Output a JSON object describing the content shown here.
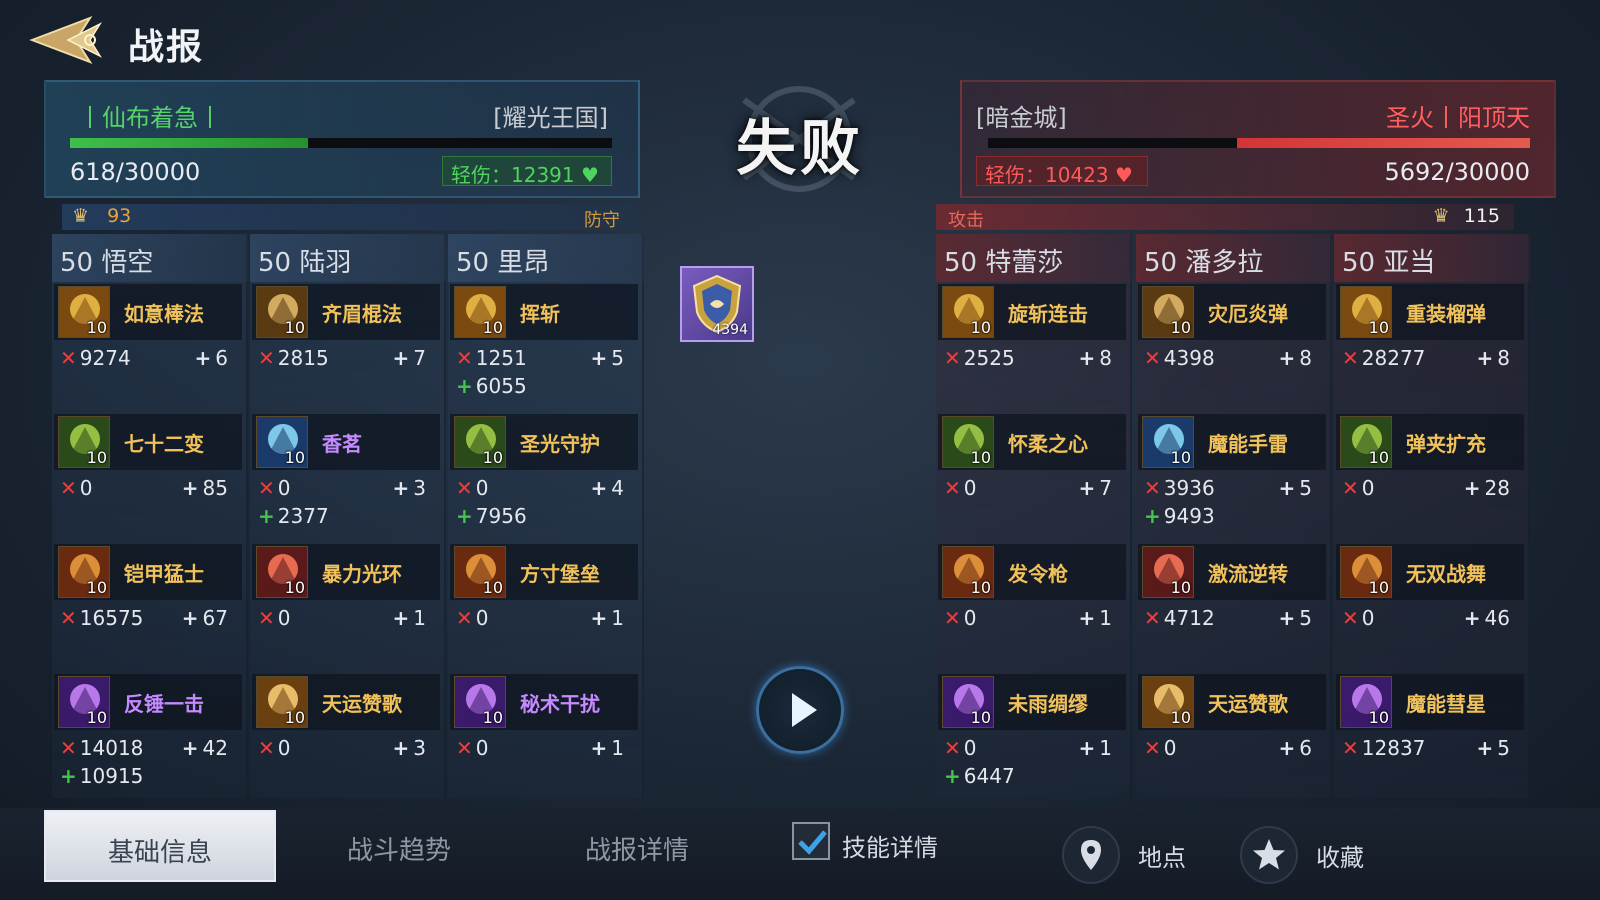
{
  "header": {
    "title": "战报"
  },
  "result": "失败",
  "left_player": {
    "name": "丨仙布着急丨",
    "kingdom": "[耀光王国]",
    "hp_text": "618/30000",
    "hp_fraction": 0.44,
    "injury": "轻伤：12391",
    "count": "93",
    "role": "防守"
  },
  "right_player": {
    "kingdom": "[暗金城]",
    "name": "圣火丨阳顶天",
    "hp_text": "5692/30000",
    "hp_fraction": 0.54,
    "injury": "轻伤：10423",
    "count": "115",
    "role": "攻击"
  },
  "center_item": {
    "count": "4394"
  },
  "left_heroes": [
    {
      "name": "50 悟空",
      "skills": [
        {
          "name": "如意棒法",
          "level": "10",
          "damage": "9274",
          "count": "6",
          "heal": ""
        },
        {
          "name": "七十二变",
          "level": "10",
          "damage": "0",
          "count": "85",
          "heal": ""
        },
        {
          "name": "铠甲猛士",
          "level": "10",
          "damage": "16575",
          "count": "67",
          "heal": ""
        },
        {
          "name": "反锤一击",
          "level": "10",
          "damage": "14018",
          "count": "42",
          "heal": "10915"
        }
      ]
    },
    {
      "name": "50 陆羽",
      "skills": [
        {
          "name": "齐眉棍法",
          "level": "10",
          "damage": "2815",
          "count": "7",
          "heal": ""
        },
        {
          "name": "香茗",
          "level": "10",
          "damage": "0",
          "count": "3",
          "heal": "2377"
        },
        {
          "name": "暴力光环",
          "level": "10",
          "damage": "0",
          "count": "1",
          "heal": ""
        },
        {
          "name": "天运赞歌",
          "level": "10",
          "damage": "0",
          "count": "3",
          "heal": ""
        }
      ]
    },
    {
      "name": "50 里昂",
      "skills": [
        {
          "name": "挥斩",
          "level": "10",
          "damage": "1251",
          "count": "5",
          "heal": "6055"
        },
        {
          "name": "圣光守护",
          "level": "10",
          "damage": "0",
          "count": "4",
          "heal": "7956"
        },
        {
          "name": "方寸堡垒",
          "level": "10",
          "damage": "0",
          "count": "1",
          "heal": ""
        },
        {
          "name": "秘术干扰",
          "level": "10",
          "damage": "0",
          "count": "1",
          "heal": ""
        }
      ]
    }
  ],
  "right_heroes": [
    {
      "name": "50 特蕾莎",
      "skills": [
        {
          "name": "旋斩连击",
          "level": "10",
          "damage": "2525",
          "count": "8",
          "heal": ""
        },
        {
          "name": "怀柔之心",
          "level": "10",
          "damage": "0",
          "count": "7",
          "heal": ""
        },
        {
          "name": "发令枪",
          "level": "10",
          "damage": "0",
          "count": "1",
          "heal": ""
        },
        {
          "name": "未雨绸缪",
          "level": "10",
          "damage": "0",
          "count": "1",
          "heal": "6447"
        }
      ]
    },
    {
      "name": "50 潘多拉",
      "skills": [
        {
          "name": "灾厄炎弹",
          "level": "10",
          "damage": "4398",
          "count": "8",
          "heal": ""
        },
        {
          "name": "魔能手雷",
          "level": "10",
          "damage": "3936",
          "count": "5",
          "heal": "9493"
        },
        {
          "name": "激流逆转",
          "level": "10",
          "damage": "4712",
          "count": "5",
          "heal": ""
        },
        {
          "name": "天运赞歌",
          "level": "10",
          "damage": "0",
          "count": "6",
          "heal": ""
        }
      ]
    },
    {
      "name": "50 亚当",
      "skills": [
        {
          "name": "重装榴弹",
          "level": "10",
          "damage": "28277",
          "count": "8",
          "heal": ""
        },
        {
          "name": "弹夹扩充",
          "level": "10",
          "damage": "0",
          "count": "28",
          "heal": ""
        },
        {
          "name": "无双战舞",
          "level": "10",
          "damage": "0",
          "count": "46",
          "heal": ""
        },
        {
          "name": "魔能彗星",
          "level": "10",
          "damage": "12837",
          "count": "5",
          "heal": ""
        }
      ]
    }
  ],
  "tabs": [
    {
      "label": "基础信息",
      "active": true
    },
    {
      "label": "战斗趋势",
      "active": false
    },
    {
      "label": "战报详情",
      "active": false
    }
  ],
  "skill_detail_toggle": {
    "label": "技能详情",
    "checked": true
  },
  "location_label": "地点",
  "favorite_label": "收藏"
}
